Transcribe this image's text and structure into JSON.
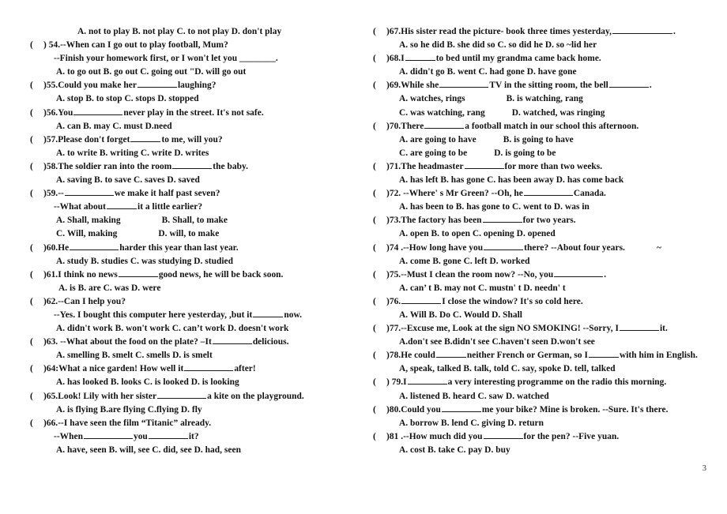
{
  "document": {
    "page_number": "3",
    "title": "English Grammar Multiple Choice Worksheet",
    "columns": 2
  },
  "left_column": {
    "orphan_options": "A. not to play    B. not play      C. to not play    D. don't play",
    "questions": [
      {
        "marker": "(",
        "number": ") 54.",
        "stem": "--When can I go out to play football, Mum?",
        "stem2": "--Finish your homework first, or I won't let you ________.",
        "options": "A. to go out     B. go out      C. going out     \"D. will go out"
      },
      {
        "marker": "(",
        "number": ")55.",
        "stem_a": "Could you make her",
        "stem_b": "laughing?",
        "options": "A. stop       B. to stop      C. stops      D. stopped"
      },
      {
        "marker": "(",
        "number": ")56.",
        "stem_a": "You",
        "stem_b": "never play in the street. It's not safe.",
        "options": "A. can         B. may       C. must       D.need"
      },
      {
        "marker": "(",
        "number": ")57.",
        "stem_a": "Please don't forget",
        "stem_b": "to me, will you?",
        "options": "A. to write    B. writing      C. write     D. writes"
      },
      {
        "marker": "(",
        "number": ")58.",
        "stem_a": "The soldier ran into the room",
        "stem_b": "the baby.",
        "options": "A. saving      B. to save     C. saves      D. saved"
      },
      {
        "marker": "(",
        "number": ")59.--",
        "stem_a": "",
        "stem_b": "we make it half past seven?",
        "stem2_a": "--What about",
        "stem2_b": "it a little earlier?",
        "options_row1_a": "A. Shall, making",
        "options_row1_b": "B. Shall, to make",
        "options_row2_a": "C. Will, making",
        "options_row2_b": "D. will, to make"
      },
      {
        "marker": "(",
        "number": ")60.",
        "stem_a": "He",
        "stem_b": "harder this year than last year.",
        "options": "A. study       B. studies      C. was studying  D. studied"
      },
      {
        "marker": "(",
        "number": ")61.",
        "stem_a": "I think no news",
        "stem_b": "good news, he will be back soon.",
        "options": "A. is        B. are       C. was        D. were"
      },
      {
        "marker": "(",
        "number": ")62.--",
        "stem": "Can I help you?",
        "stem2_a": "--Yes. I bought this computer here yesterday, ,but it",
        "stem2_b": "now.",
        "options": "A. didn't work   B. won't work   C. can’t work   D. doesn't work"
      },
      {
        "marker": "(",
        "number": ")63. --",
        "stem_a": "What about the food on the plate? –It",
        "stem_b": "delicious.",
        "options": "A. smelling     B. smelt       C. smells    D. is smelt"
      },
      {
        "marker": "(",
        "number": ")64:",
        "stem_a": "What a nice garden! How well it",
        "stem_b": "after!",
        "options": "A. has looked   B. looks        C. is looked     D. is looking"
      },
      {
        "marker": "(",
        "number": ")65.",
        "stem_a": "Look! Lily with her sister",
        "stem_b": "a kite on the playground.",
        "options": "A. is flying   B.are flying     C.flying   D. fly"
      },
      {
        "marker": "(",
        "number": ")66.--",
        "stem": "I have seen the film “Titanic” already.",
        "stem2_a": "--When",
        "stem2_b": "you",
        "stem2_c": "it?",
        "options": "A. have, seen   B. will, see     C. did, see      D. had, seen"
      }
    ]
  },
  "right_column": {
    "questions": [
      {
        "marker": "(",
        "number": ")67.",
        "stem_a": "His sister read the picture- book three times yesterday,",
        "stem_b": ".",
        "options": "A. so he did    B. she did so     C. so did he     D. so ~lid her"
      },
      {
        "marker": "(",
        "number": ")68.",
        "stem_a": "I",
        "stem_b": "to bed until my grandma came back home.",
        "options": "A. didn't go    B. went       C. had gone    D. have gone"
      },
      {
        "marker": "(",
        "number": ")69.",
        "stem_a": "While she",
        "stem_b": "TV in the sitting room, the bell",
        "stem_c": ".",
        "options_row1_a": "A. watches, rings",
        "options_row1_b": "B. is watching, rang",
        "options_row2_a": "C. was watching, rang",
        "options_row2_b": "D. watched, was ringing"
      },
      {
        "marker": "(",
        "number": ")70.",
        "stem_a": "There",
        "stem_b": "a football match in our school this afternoon.",
        "options_row1_a": "A. are going to have",
        "options_row1_b": "B. is going to have",
        "options_row2_a": "C. are going to be",
        "options_row2_b": "D. is going to be"
      },
      {
        "marker": "(",
        "number": ")71.",
        "stem_a": "The headmaster",
        "stem_b": "for more than two weeks.",
        "options": "A. has left     B. has gone     C. has been away  D. has come back"
      },
      {
        "marker": "(",
        "number": ")72. --",
        "stem_a": "Where' s Mr Green? --Oh, he",
        "stem_b": "Canada.",
        "options": "A. has been to  B. has gone to    C. went to       D. was in"
      },
      {
        "marker": "(",
        "number": ")73.",
        "stem_a": "The factory has been",
        "stem_b": "for two years.",
        "options": "A. open      B. to open     C. opening     D. opened"
      },
      {
        "marker": "(",
        "number": ")74 .--",
        "stem_a": "How long have you",
        "stem_b": "there? --About four years.",
        "trailing_mark": "~",
        "options": "A. come       B. gone      C. left       D. worked"
      },
      {
        "marker": "(",
        "number": ")75.--",
        "stem_a": "Must I clean the room now? --No, you",
        "stem_b": ".",
        "options": "A. can’ t     B. may not    C. mustn' t     D. needn' t"
      },
      {
        "marker": "(",
        "number": ")76.",
        "stem_a": "",
        "stem_b": "I close the window? It's so cold here.",
        "options": "A. Will      B. Do        C. Would     D. Shall"
      },
      {
        "marker": "(",
        "number": ")77.--",
        "stem_a": "Excuse me, Look at the sign NO SMOKING! --Sorry, I",
        "stem_b": "it.",
        "options": "A.don't see   B.didn't see    C.haven't seen   D.won't see"
      },
      {
        "marker": "(",
        "number": ")78.",
        "stem_a": "He could",
        "stem_b": "neither French or German, so I",
        "stem_c": "with him in English.",
        "options": "A, speak, talked B. talk, told     C. say, spoke   D. tell, talked"
      },
      {
        "marker": "(",
        "number": ") 79.",
        "stem_a": "I",
        "stem_b": "a very interesting programme on the radio this morning.",
        "options": "A. listened    B. heard      C. saw        D. watched"
      },
      {
        "marker": "(",
        "number": ")80.",
        "stem_a": "Could you",
        "stem_b": "me your bike? Mine is broken. --Sure. It's there.",
        "options": "A. borrow     B. lend      C. giving     D. return"
      },
      {
        "marker": "(",
        "number": ")81 .--",
        "stem_a": "How much did you",
        "stem_b": "for the pen? --Five yuan.",
        "options": "A. cost      B. take      C. pay       D. buy"
      }
    ]
  }
}
